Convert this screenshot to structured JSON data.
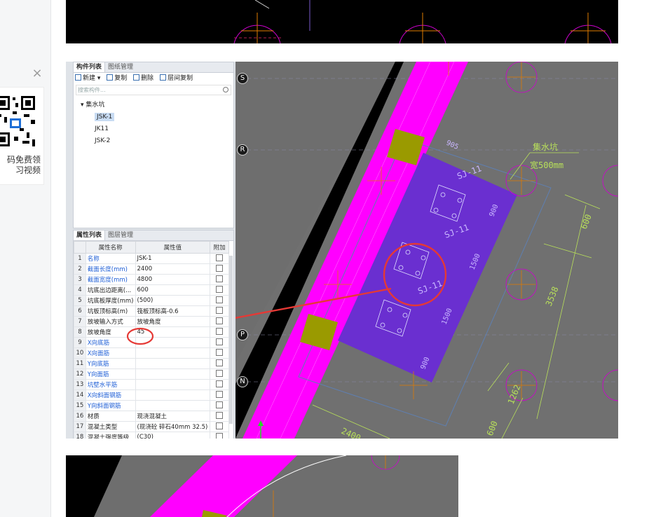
{
  "sidebar": {
    "close_label": "×",
    "qr_text_line1": "码免费领",
    "qr_text_line2": "习视频"
  },
  "component_panel": {
    "tabs": [
      "构件列表",
      "图纸管理"
    ],
    "toolbar": {
      "new": "新建",
      "copy": "复制",
      "delete": "删除",
      "floor_copy": "层间复制"
    },
    "search_placeholder": "搜索构件...",
    "tree": {
      "root": "集水坑",
      "items": [
        "JSK-1",
        "JK11",
        "JSK-2"
      ],
      "selected": "JSK-1"
    }
  },
  "property_panel": {
    "tabs": [
      "属性列表",
      "图层管理"
    ],
    "columns": [
      "属性名称",
      "属性值",
      "附加"
    ],
    "rows": [
      {
        "n": "1",
        "name": "名称",
        "value": "JSK-1",
        "blue": true
      },
      {
        "n": "2",
        "name": "截面长度(mm)",
        "value": "2400",
        "blue": true
      },
      {
        "n": "3",
        "name": "截面宽度(mm)",
        "value": "4800",
        "blue": true
      },
      {
        "n": "4",
        "name": "坑底出边距离(...",
        "value": "600",
        "blue": false
      },
      {
        "n": "5",
        "name": "坑底板厚度(mm)",
        "value": "(500)",
        "blue": false
      },
      {
        "n": "6",
        "name": "坑板顶标高(m)",
        "value": "筏板顶标高-0.6",
        "blue": false
      },
      {
        "n": "7",
        "name": "放坡输入方式",
        "value": "放坡角度",
        "blue": false
      },
      {
        "n": "8",
        "name": "放坡角度",
        "value": "45",
        "blue": false
      },
      {
        "n": "9",
        "name": "X向底筋",
        "value": "",
        "blue": true
      },
      {
        "n": "10",
        "name": "X向面筋",
        "value": "",
        "blue": true
      },
      {
        "n": "11",
        "name": "Y向底筋",
        "value": "",
        "blue": true
      },
      {
        "n": "12",
        "name": "Y向面筋",
        "value": "",
        "blue": true
      },
      {
        "n": "13",
        "name": "坑壁水平筋",
        "value": "",
        "blue": true
      },
      {
        "n": "14",
        "name": "X向斜面钢筋",
        "value": "",
        "blue": true
      },
      {
        "n": "15",
        "name": "Y向斜面钢筋",
        "value": "",
        "blue": true
      },
      {
        "n": "16",
        "name": "材质",
        "value": "现浇混凝土",
        "blue": false
      },
      {
        "n": "17",
        "name": "混凝土类型",
        "value": "(现浇砼 碎石40mm 32.5)",
        "blue": false
      },
      {
        "n": "18",
        "name": "混凝土强度等级",
        "value": "(C30)",
        "blue": false
      }
    ]
  },
  "cad": {
    "axis_labels": [
      "S",
      "R",
      "P",
      "N"
    ],
    "labels": {
      "sj11_a": "SJ-11",
      "sj11_b": "SJ-11",
      "sj11_c": "SJ-11",
      "slope_note": "集水坑",
      "slope_width": "宽500mm",
      "dim_900a": "900",
      "dim_1500a": "1500",
      "dim_1500b": "1500",
      "dim_900b": "900",
      "dim_600a": "600",
      "dim_3538": "3538",
      "dim_1262": "1262",
      "dim_600b": "600",
      "dim_2400": "2400",
      "dim_905": "905"
    }
  },
  "colors": {
    "slab": "#ff00ff",
    "pit": "#6a2fd0",
    "column": "#9a9a00",
    "annotation": "#e53935",
    "dim_line": "#b8e05a"
  }
}
